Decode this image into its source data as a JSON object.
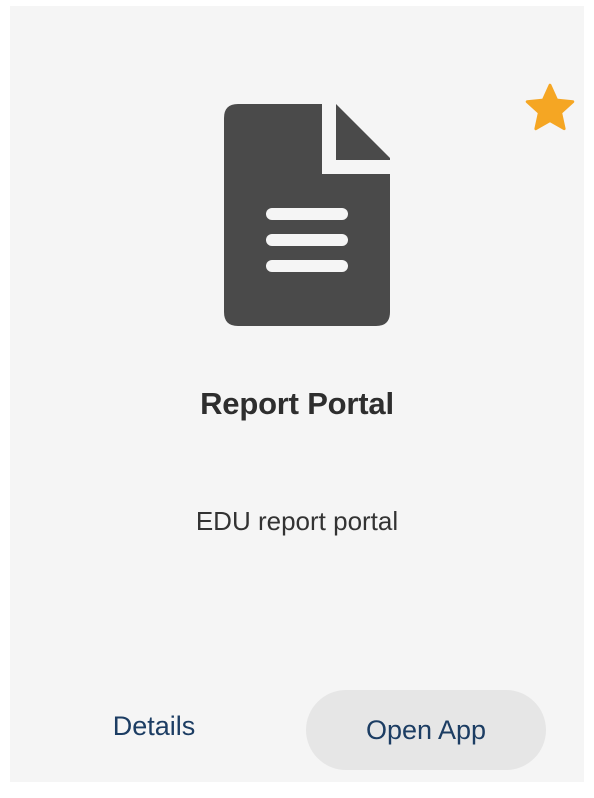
{
  "card": {
    "favorite": {
      "icon": "star-icon",
      "active": true,
      "color": "#f5a623"
    },
    "app_icon": {
      "icon": "document-icon",
      "color": "#4a4a4a"
    },
    "title": "Report Portal",
    "description": "EDU report portal",
    "actions": {
      "details_label": "Details",
      "open_label": "Open App"
    }
  }
}
